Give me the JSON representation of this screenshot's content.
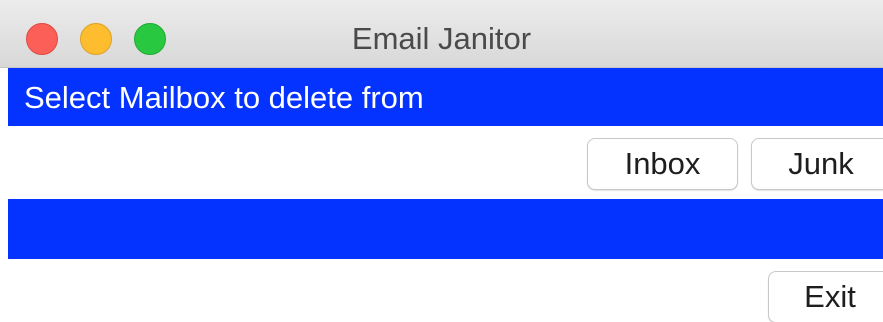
{
  "window": {
    "title": "Email Janitor",
    "controls": [
      "close",
      "minimize",
      "zoom"
    ]
  },
  "mailbox_section": {
    "heading": "Select Mailbox to delete from",
    "buttons": {
      "inbox": "Inbox",
      "junk": "Junk"
    }
  },
  "footer": {
    "exit_label": "Exit"
  },
  "colors": {
    "banner": "#0433ff",
    "close": "#fc5f57",
    "minimize": "#fdbd2e",
    "zoom": "#28c840"
  }
}
